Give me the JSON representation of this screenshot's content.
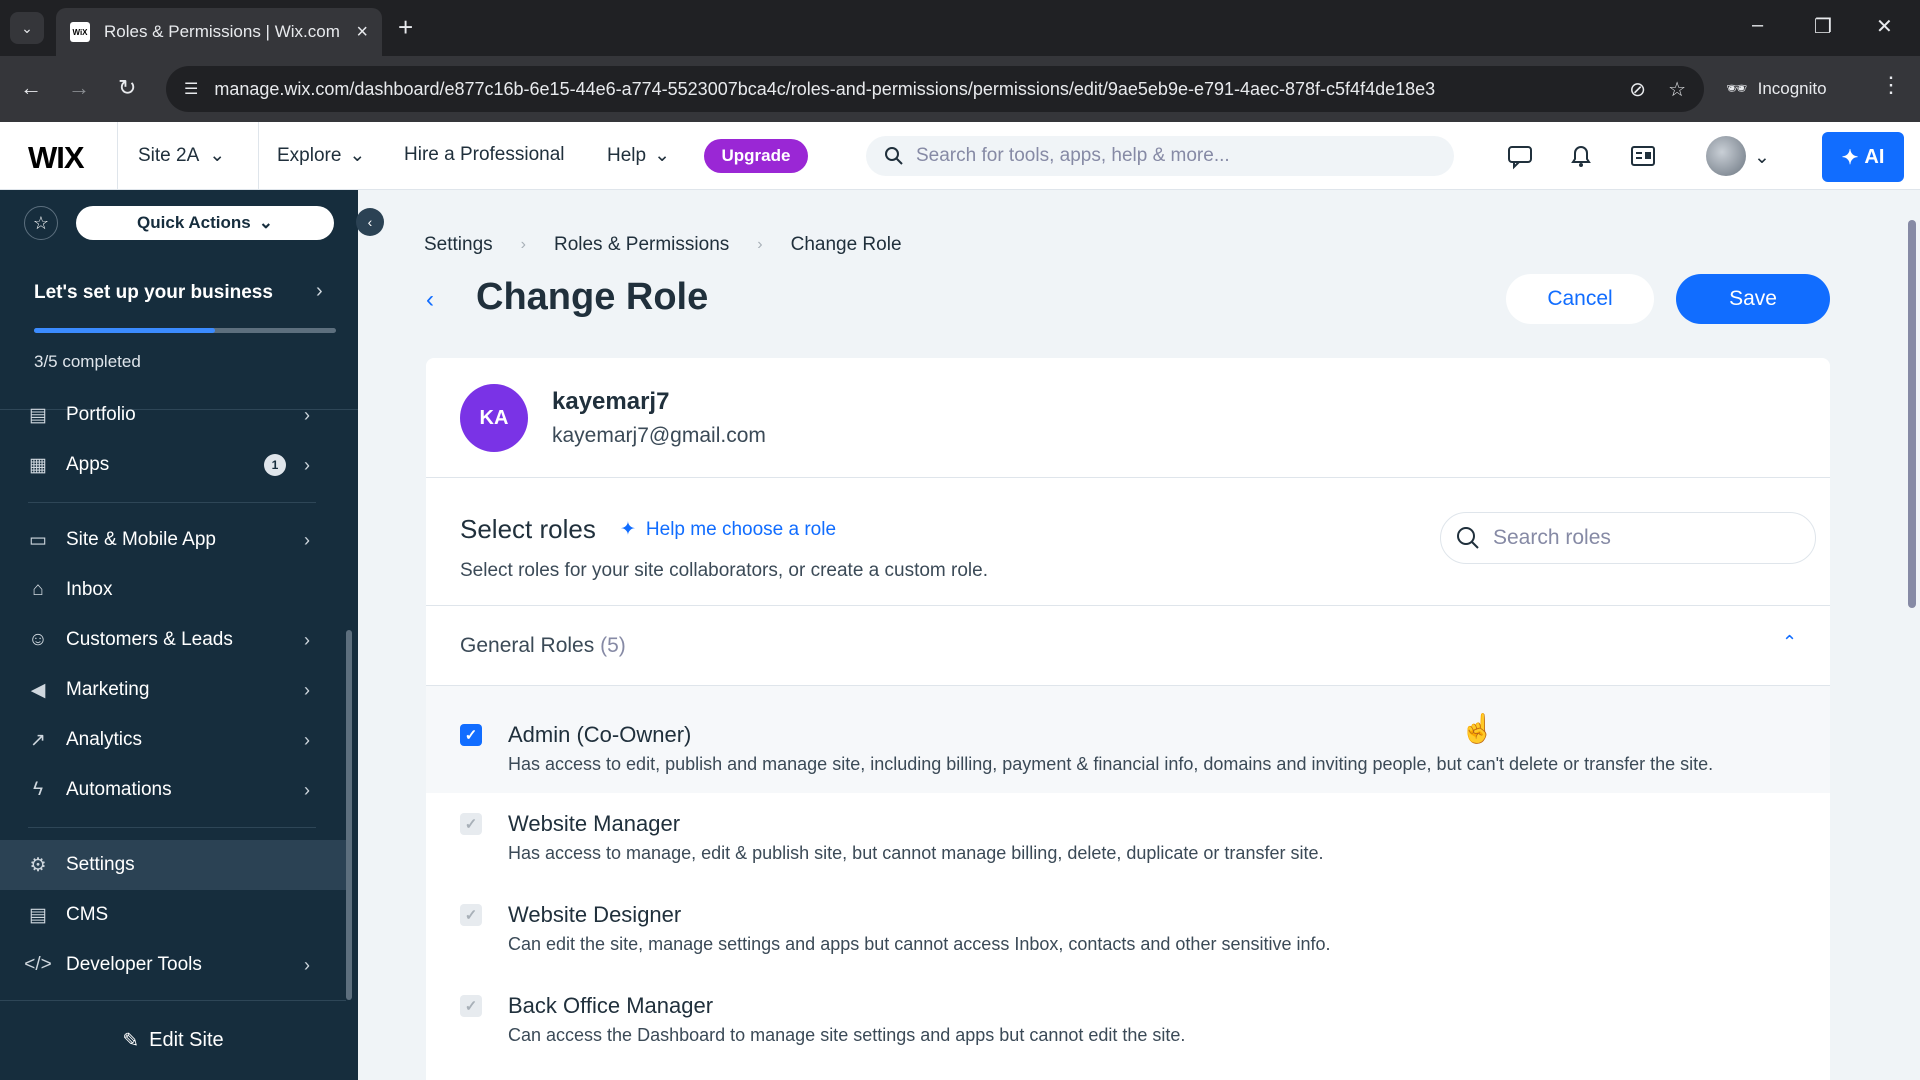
{
  "browser": {
    "tab_title": "Roles & Permissions | Wix.com",
    "favicon_text": "WiX",
    "url": "manage.wix.com/dashboard/e877c16b-6e15-44e6-a774-5523007bca4c/roles-and-permissions/permissions/edit/9ae5eb9e-e791-4aec-878f-c5f4f4de18e3",
    "incognito_label": "Incognito"
  },
  "topbar": {
    "logo": "WIX",
    "site_name": "Site 2A",
    "explore": "Explore",
    "hire": "Hire a Professional",
    "help": "Help",
    "upgrade": "Upgrade",
    "search_placeholder": "Search for tools, apps, help & more...",
    "ai_label": "AI"
  },
  "sidebar": {
    "quick_actions": "Quick Actions",
    "setup_title": "Let's set up your business",
    "setup_progress": 0.6,
    "setup_count": "3/5 completed",
    "items": [
      {
        "label": "Portfolio",
        "chevron": true
      },
      {
        "label": "Apps",
        "chevron": true,
        "badge": "1"
      },
      {
        "label": "Site & Mobile App",
        "chevron": true
      },
      {
        "label": "Inbox",
        "chevron": false
      },
      {
        "label": "Customers & Leads",
        "chevron": true
      },
      {
        "label": "Marketing",
        "chevron": true
      },
      {
        "label": "Analytics",
        "chevron": true
      },
      {
        "label": "Automations",
        "chevron": true
      },
      {
        "label": "Settings",
        "chevron": false,
        "active": true
      },
      {
        "label": "CMS",
        "chevron": false
      },
      {
        "label": "Developer Tools",
        "chevron": true
      }
    ],
    "edit_site": "Edit Site"
  },
  "main": {
    "breadcrumb": [
      "Settings",
      "Roles & Permissions",
      "Change Role"
    ],
    "title": "Change Role",
    "cancel": "Cancel",
    "save": "Save",
    "user": {
      "initials": "KA",
      "name": "kayemarj7",
      "email": "kayemarj7@gmail.com"
    },
    "select_roles_title": "Select roles",
    "help_choose": "Help me choose a role",
    "select_roles_sub": "Select roles for your site collaborators, or create a custom role.",
    "search_roles_placeholder": "Search roles",
    "group_title": "General Roles",
    "group_count": "(5)",
    "roles": [
      {
        "name": "Admin (Co-Owner)",
        "desc": "Has access to edit, publish and manage site, including billing, payment & financial info, domains and inviting people, but can't delete or transfer the site.",
        "checked": true
      },
      {
        "name": "Website Manager",
        "desc": "Has access to manage, edit & publish site, but cannot manage billing, delete, duplicate or transfer site.",
        "checked": true,
        "disabled": true
      },
      {
        "name": "Website Designer",
        "desc": "Can edit the site, manage settings and apps but cannot access Inbox, contacts and other sensitive info.",
        "checked": true,
        "disabled": true
      },
      {
        "name": "Back Office Manager",
        "desc": "Can access the Dashboard to manage site settings and apps but cannot edit the site.",
        "checked": true,
        "disabled": true
      }
    ]
  },
  "colors": {
    "accent": "#116dff",
    "sidebar_bg": "#162d3d",
    "upgrade": "#9a27d5",
    "avatar": "#7a33e6"
  }
}
